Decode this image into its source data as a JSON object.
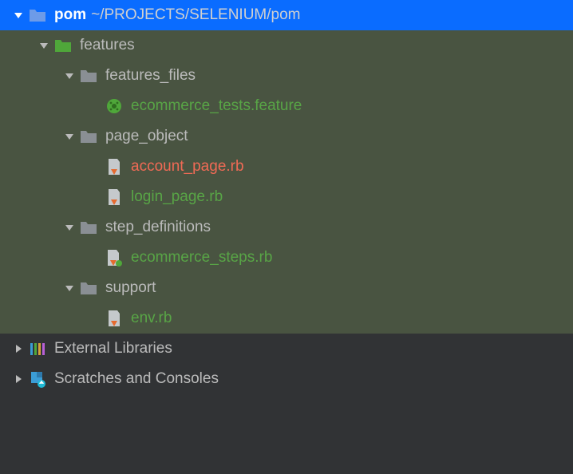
{
  "root": {
    "name": "pom",
    "path": "~/PROJECTS/SELENIUM/pom"
  },
  "features": {
    "label": "features",
    "features_files": {
      "label": "features_files",
      "ecommerce": "ecommerce_tests.feature"
    },
    "page_object": {
      "label": "page_object",
      "account": "account_page.rb",
      "login": "login_page.rb"
    },
    "step_definitions": {
      "label": "step_definitions",
      "ecommerce_steps": "ecommerce_steps.rb"
    },
    "support": {
      "label": "support",
      "env": "env.rb"
    }
  },
  "external_libs": "External Libraries",
  "scratches": "Scratches and Consoles"
}
